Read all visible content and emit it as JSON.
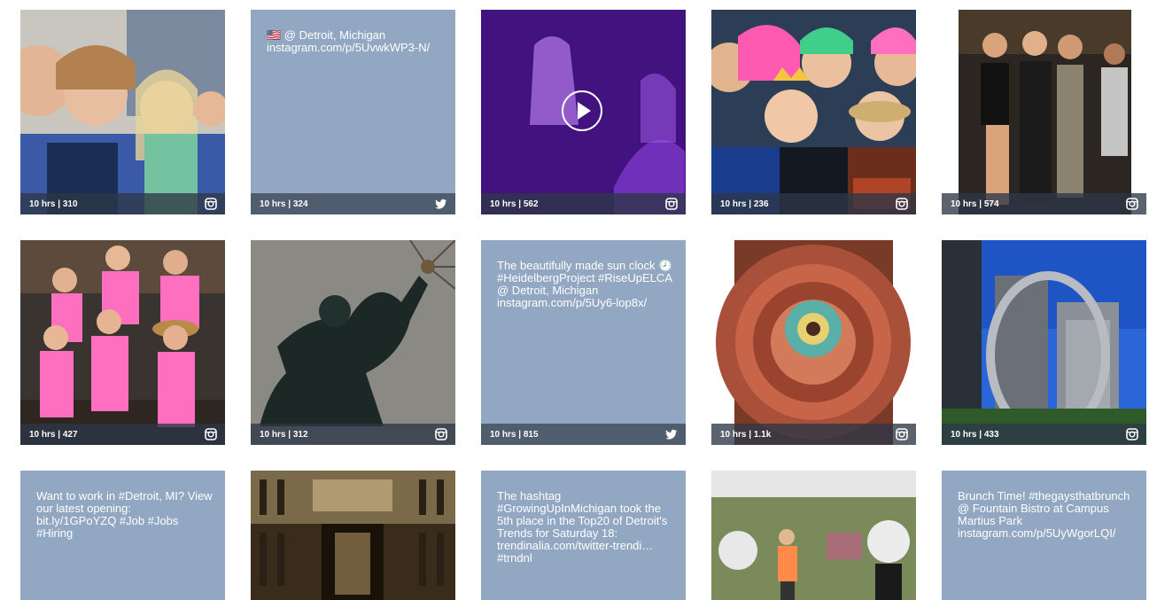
{
  "tiles": [
    {
      "kind": "photo",
      "meta": "10 hrs | 310",
      "service": "instagram-icon"
    },
    {
      "kind": "text",
      "text": "🇺🇸 @ Detroit, Michigan instagram.com/p/5UvwkWP3-N/",
      "meta": "10 hrs | 324",
      "service": "twitter-icon"
    },
    {
      "kind": "video",
      "meta": "10 hrs | 562",
      "service": "instagram-icon"
    },
    {
      "kind": "photo",
      "meta": "10 hrs | 236",
      "service": "instagram-icon"
    },
    {
      "kind": "photo",
      "meta": "10 hrs | 574",
      "service": "instagram-icon"
    },
    {
      "kind": "photo",
      "meta": "10 hrs | 427",
      "service": "instagram-icon"
    },
    {
      "kind": "photo",
      "meta": "10 hrs | 312",
      "service": "instagram-icon"
    },
    {
      "kind": "text",
      "text": "The beautifully made sun clock 🕗 #HeidelbergProject #RiseUpELCA @ Detroit, Michigan instagram.com/p/5Uy6-lop8x/",
      "meta": "10 hrs | 815",
      "service": "twitter-icon"
    },
    {
      "kind": "photo",
      "meta": "10 hrs | 1.1k",
      "service": "instagram-icon"
    },
    {
      "kind": "photo",
      "meta": "10 hrs | 433",
      "service": "instagram-icon"
    },
    {
      "kind": "text",
      "text": "Want to work in #Detroit, MI? View our latest opening: bit.ly/1GPoYZQ #Job #Jobs #Hiring",
      "meta": "",
      "service": ""
    },
    {
      "kind": "photo",
      "meta": "",
      "service": ""
    },
    {
      "kind": "text",
      "text": "The hashtag #GrowingUpInMichigan took the 5th place in the Top20 of Detroit's Trends for Saturday 18: trendinalia.com/twitter-trendi… #trndnl",
      "meta": "",
      "service": ""
    },
    {
      "kind": "photo",
      "meta": "",
      "service": ""
    },
    {
      "kind": "text",
      "text": "Brunch Time! #thegaysthatbrunch @ Fountain Bistro at Campus Martius Park instagram.com/p/5UyWgorLQI/",
      "meta": "",
      "service": ""
    }
  ]
}
